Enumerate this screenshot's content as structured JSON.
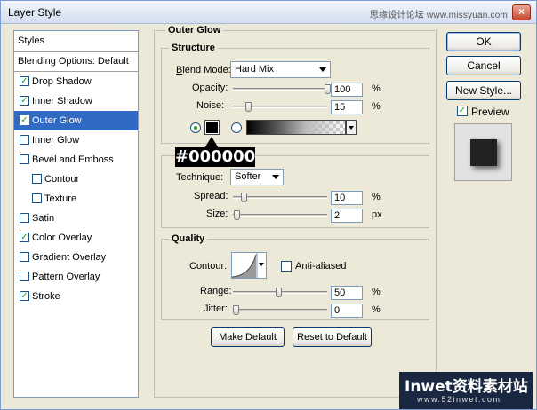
{
  "window": {
    "title": "Layer Style",
    "watermark_top": "思缘设计论坛 www.missyuan.com",
    "close_glyph": "×"
  },
  "left_panel": {
    "header": "Styles",
    "blending_options": "Blending Options: Default",
    "items": [
      {
        "label": "Drop Shadow",
        "checked": true,
        "indent": false,
        "selected": false
      },
      {
        "label": "Inner Shadow",
        "checked": true,
        "indent": false,
        "selected": false
      },
      {
        "label": "Outer Glow",
        "checked": true,
        "indent": false,
        "selected": true
      },
      {
        "label": "Inner Glow",
        "checked": false,
        "indent": false,
        "selected": false
      },
      {
        "label": "Bevel and Emboss",
        "checked": false,
        "indent": false,
        "selected": false
      },
      {
        "label": "Contour",
        "checked": false,
        "indent": true,
        "selected": false
      },
      {
        "label": "Texture",
        "checked": false,
        "indent": true,
        "selected": false
      },
      {
        "label": "Satin",
        "checked": false,
        "indent": false,
        "selected": false
      },
      {
        "label": "Color Overlay",
        "checked": true,
        "indent": false,
        "selected": false
      },
      {
        "label": "Gradient Overlay",
        "checked": false,
        "indent": false,
        "selected": false
      },
      {
        "label": "Pattern Overlay",
        "checked": false,
        "indent": false,
        "selected": false
      },
      {
        "label": "Stroke",
        "checked": true,
        "indent": false,
        "selected": false
      }
    ]
  },
  "outer_glow": {
    "title": "Outer Glow",
    "structure": {
      "title": "Structure",
      "blend_mode_label": "Blend Mode:",
      "blend_mode_value": "Hard Mix",
      "opacity_label": "Opacity:",
      "opacity_value": "100",
      "opacity_level": 1.0,
      "noise_label": "Noise:",
      "noise_value": "15",
      "noise_level": 0.15,
      "percent": "%",
      "glow_color": "#000000",
      "color_callout": "#000000"
    },
    "elements": {
      "technique_label": "Technique:",
      "technique_value": "Softer",
      "spread_label": "Spread:",
      "spread_value": "10",
      "spread_level": 0.1,
      "size_label": "Size:",
      "size_value": "2",
      "size_unit": "px",
      "percent": "%"
    },
    "quality": {
      "title": "Quality",
      "contour_label": "Contour:",
      "anti_aliased_label": "Anti-aliased",
      "anti_aliased": false,
      "range_label": "Range:",
      "range_value": "50",
      "range_level": 0.5,
      "jitter_label": "Jitter:",
      "jitter_value": "0",
      "jitter_level": 0.0,
      "percent": "%"
    },
    "make_default": "Make Default",
    "reset_default": "Reset to Default"
  },
  "right_panel": {
    "ok": "OK",
    "cancel": "Cancel",
    "new_style": "New Style...",
    "preview_label": "Preview",
    "preview_checked": true
  },
  "watermark_bottom": {
    "main": "Inwet资料素材站",
    "sub": "www.52inwet.com"
  }
}
